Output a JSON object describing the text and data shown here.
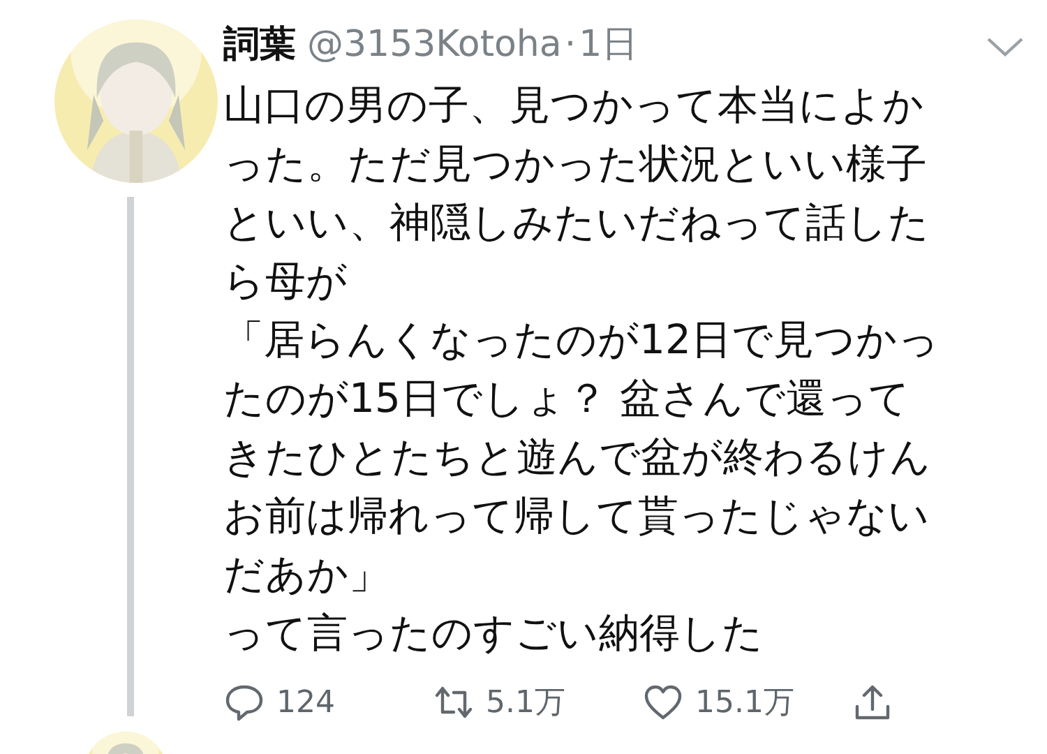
{
  "tweet": {
    "name": "詞葉",
    "handle": "@3153Kotoha",
    "separator": "·",
    "time": "1日",
    "paragraphs": [
      "山口の男の子、見つかって本当によかった。ただ見つかった状況といい様子といい、神隠しみたいだねって話したら母が",
      "「居らんくなったのが12日で見つかったのが15日でしょ？ 盆さんで還ってきたひとたちと遊んで盆が終わるけんお前は帰れって帰して貰ったじゃないだあか」",
      "って言ったのすごい納得した"
    ],
    "actions": [
      {
        "kind": "reply",
        "count": "124"
      },
      {
        "kind": "retweet",
        "count": "5.1万"
      },
      {
        "kind": "like",
        "count": "15.1万"
      },
      {
        "kind": "share"
      }
    ]
  }
}
